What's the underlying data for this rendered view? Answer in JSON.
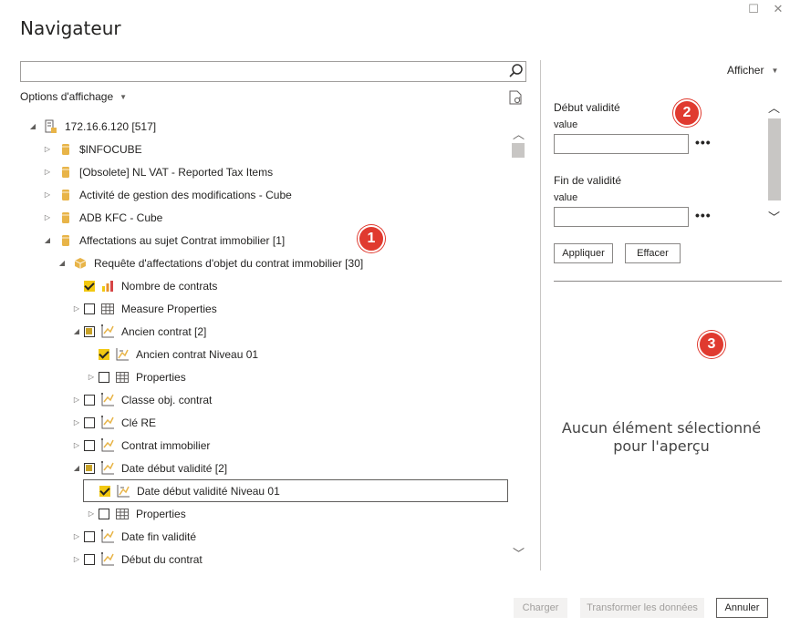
{
  "window": {
    "title": "Navigateur",
    "maximize_glyph": "☐",
    "close_glyph": "✕"
  },
  "left": {
    "search_value": "",
    "display_options_label": "Options d'affichage"
  },
  "tree": [
    {
      "depth": 0,
      "twisty": "expanded",
      "check": "none",
      "icon": "server-icon",
      "label": "172.16.6.120 [517]"
    },
    {
      "depth": 1,
      "twisty": "collapsed",
      "check": "none",
      "icon": "cube-icon",
      "label": "$INFOCUBE"
    },
    {
      "depth": 1,
      "twisty": "collapsed",
      "check": "none",
      "icon": "cube-icon",
      "label": "[Obsolete] NL VAT - Reported Tax Items"
    },
    {
      "depth": 1,
      "twisty": "collapsed",
      "check": "none",
      "icon": "cube-icon",
      "label": "Activité de gestion des modifications - Cube"
    },
    {
      "depth": 1,
      "twisty": "collapsed",
      "check": "none",
      "icon": "cube-icon",
      "label": "ADB KFC - Cube"
    },
    {
      "depth": 1,
      "twisty": "expanded",
      "check": "none",
      "icon": "cube-icon",
      "label": "Affectations au sujet Contrat immobilier [1]"
    },
    {
      "depth": 2,
      "twisty": "expanded",
      "check": "none",
      "icon": "query-icon",
      "label": "Requête d'affectations d'objet du contrat immobilier [30]"
    },
    {
      "depth": 3,
      "twisty": "none",
      "check": "on",
      "icon": "bar-chart-icon",
      "label": "Nombre de contrats"
    },
    {
      "depth": 3,
      "twisty": "collapsed",
      "check": "off",
      "icon": "table-icon",
      "label": "Measure Properties"
    },
    {
      "depth": 3,
      "twisty": "expanded",
      "check": "part",
      "icon": "hierarchy-icon",
      "label": "Ancien contrat [2]"
    },
    {
      "depth": 4,
      "twisty": "none",
      "check": "on",
      "icon": "hierarchy-level-icon",
      "label": "Ancien contrat Niveau 01"
    },
    {
      "depth": 4,
      "twisty": "collapsed",
      "check": "off",
      "icon": "table-icon",
      "label": "Properties"
    },
    {
      "depth": 3,
      "twisty": "collapsed",
      "check": "off",
      "icon": "hierarchy-icon",
      "label": "Classe obj. contrat"
    },
    {
      "depth": 3,
      "twisty": "collapsed",
      "check": "off",
      "icon": "hierarchy-icon",
      "label": "Clé RE"
    },
    {
      "depth": 3,
      "twisty": "collapsed",
      "check": "off",
      "icon": "hierarchy-icon",
      "label": "Contrat immobilier"
    },
    {
      "depth": 3,
      "twisty": "expanded",
      "check": "part",
      "icon": "hierarchy-icon",
      "label": "Date début validité [2]"
    },
    {
      "depth": 4,
      "twisty": "none",
      "check": "on",
      "icon": "hierarchy-level-icon",
      "label": "Date début validité Niveau 01",
      "selected": true
    },
    {
      "depth": 4,
      "twisty": "collapsed",
      "check": "off",
      "icon": "table-icon",
      "label": "Properties"
    },
    {
      "depth": 3,
      "twisty": "collapsed",
      "check": "off",
      "icon": "hierarchy-icon",
      "label": "Date fin validité"
    },
    {
      "depth": 3,
      "twisty": "collapsed",
      "check": "off",
      "icon": "hierarchy-icon",
      "label": "Début du contrat"
    }
  ],
  "right": {
    "view_label": "Afficher",
    "params": [
      {
        "title": "Début validité",
        "sub": "value",
        "value": ""
      },
      {
        "title": "Fin de validité",
        "sub": "value",
        "value": ""
      }
    ],
    "more_glyph": "•••",
    "apply_label": "Appliquer",
    "clear_label": "Effacer",
    "empty_message": "Aucun élément sélectionné pour l'aperçu"
  },
  "badges": [
    "1",
    "2",
    "3"
  ],
  "footer": {
    "load_label": "Charger",
    "transform_label": "Transformer les données",
    "cancel_label": "Annuler"
  },
  "colors": {
    "accent_yellow": "#f2c811",
    "badge_red": "#e03a2f",
    "cube_gold": "#e8b448"
  }
}
